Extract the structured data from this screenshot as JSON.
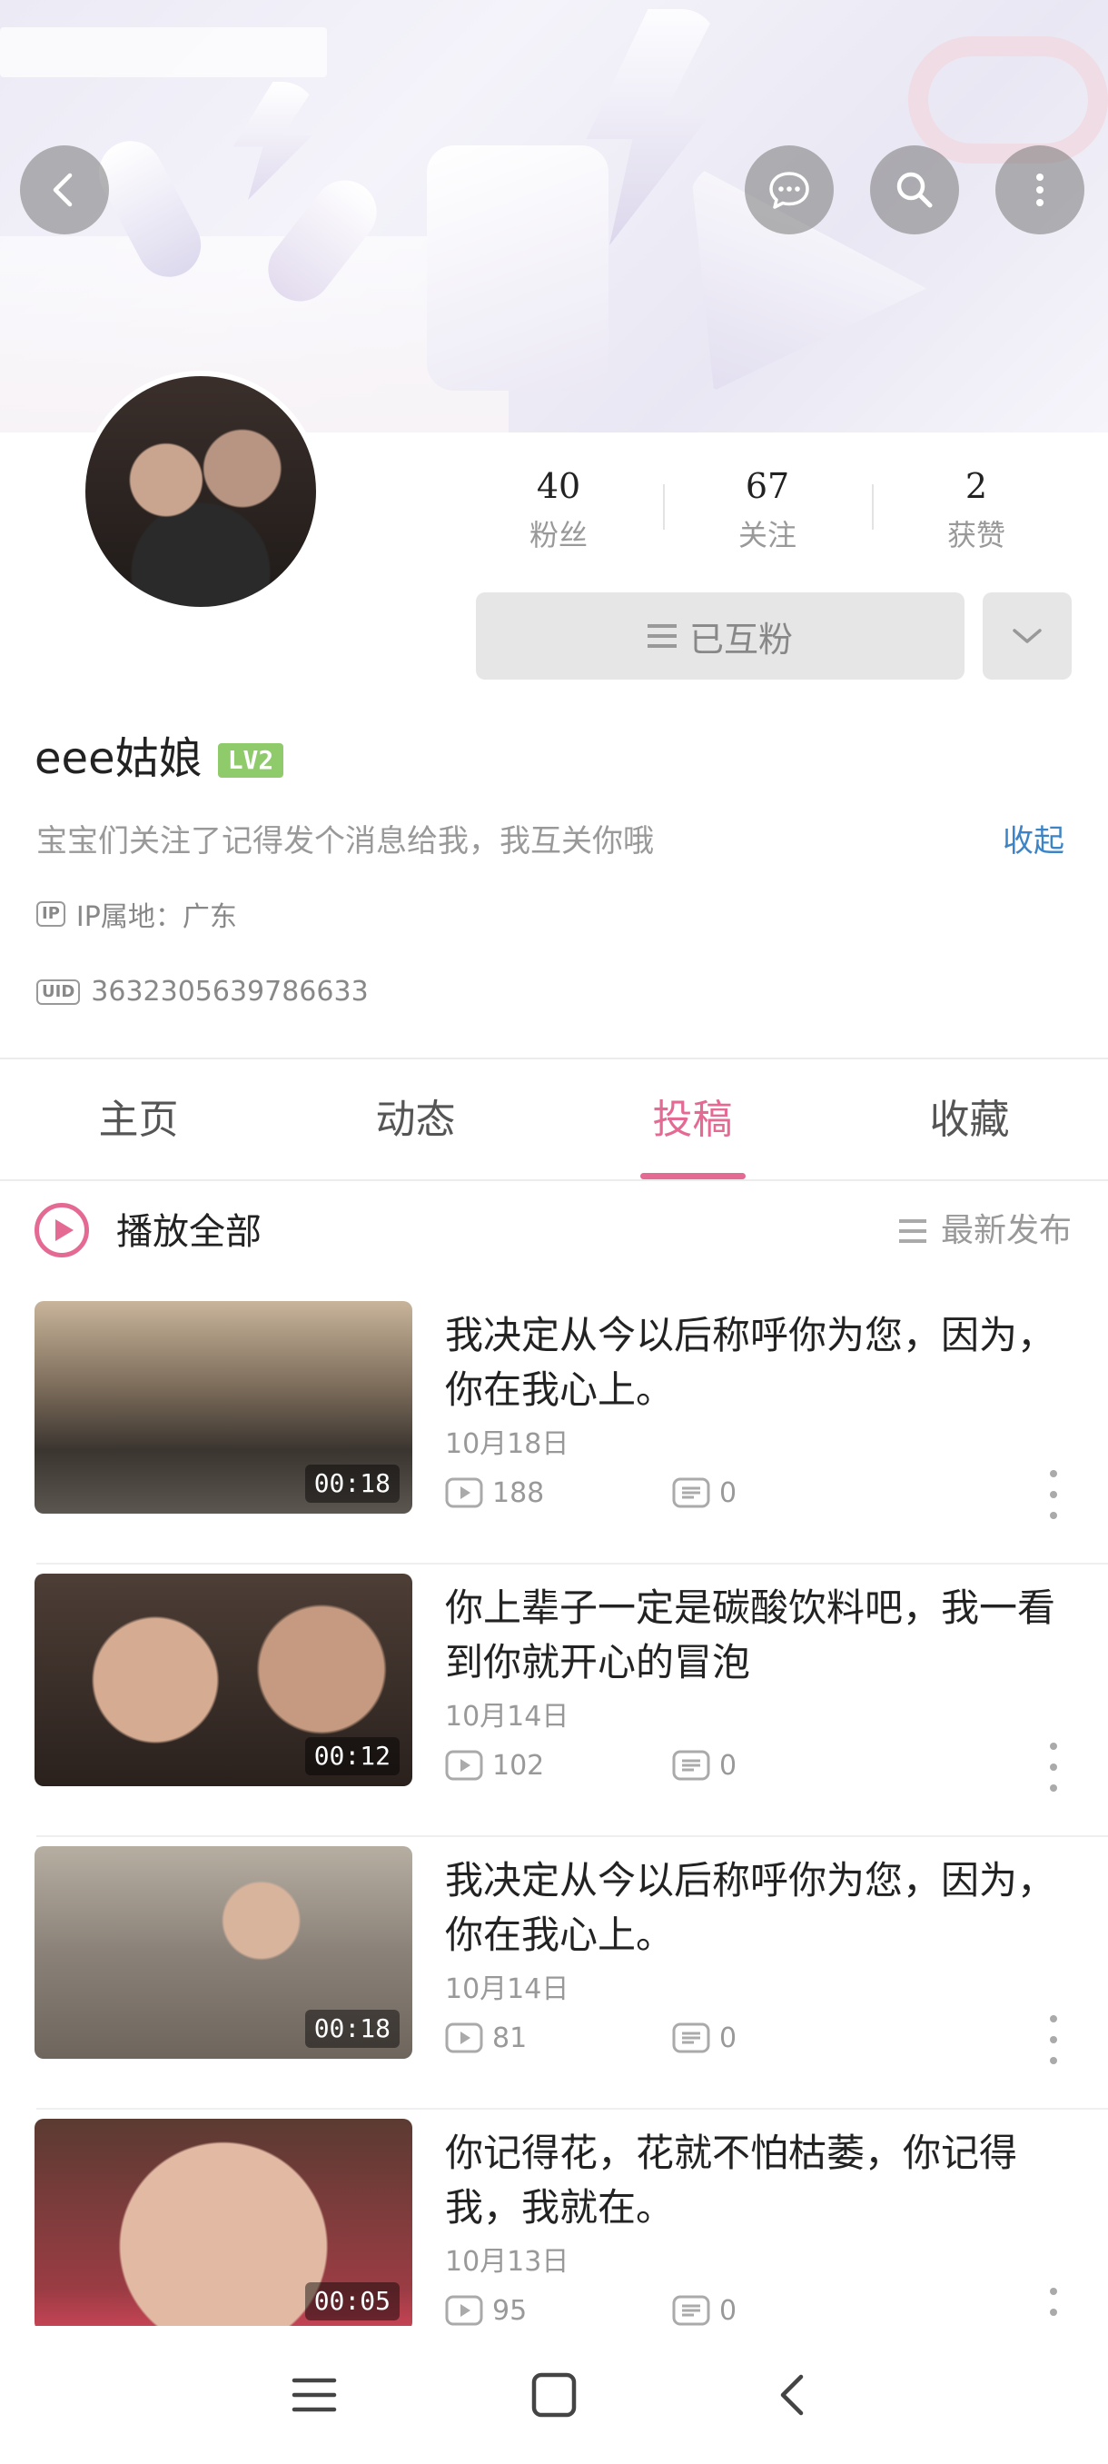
{
  "header": {
    "back_icon": "chevron-left-icon",
    "message_icon": "chat-bubble-icon",
    "search_icon": "search-icon",
    "more_icon": "more-vertical-icon"
  },
  "profile": {
    "stats": [
      {
        "value": "40",
        "label": "粉丝"
      },
      {
        "value": "67",
        "label": "关注"
      },
      {
        "value": "2",
        "label": "获赞"
      }
    ],
    "follow_status": "已互粉",
    "username": "eee姑娘",
    "level": "LV2",
    "bio": "宝宝们关注了记得发个消息给我，我互关你哦",
    "collapse": "收起",
    "ip_tag": "IP",
    "ip_location": "IP属地：广东",
    "uid_tag": "UID",
    "uid": "3632305639786633"
  },
  "tabs": [
    {
      "label": "主页",
      "active": false
    },
    {
      "label": "动态",
      "active": false
    },
    {
      "label": "投稿",
      "active": true
    },
    {
      "label": "收藏",
      "active": false
    }
  ],
  "list_header": {
    "play_all": "播放全部",
    "sort": "最新发布"
  },
  "videos": [
    {
      "title": "我决定从今以后称呼你为您，因为，你在我心上。",
      "date": "10月18日",
      "plays": "188",
      "comments": "0",
      "duration": "00:18"
    },
    {
      "title": "你上辈子一定是碳酸饮料吧，我一看到你就开心的冒泡",
      "date": "10月14日",
      "plays": "102",
      "comments": "0",
      "duration": "00:12"
    },
    {
      "title": "我决定从今以后称呼你为您，因为，你在我心上。",
      "date": "10月14日",
      "plays": "81",
      "comments": "0",
      "duration": "00:18"
    },
    {
      "title": "你记得花，花就不怕枯萎，你记得我，我就在。",
      "date": "10月13日",
      "plays": "95",
      "comments": "0",
      "duration": "00:05"
    }
  ],
  "colors": {
    "accent": "#e46a93",
    "link": "#3d84c6",
    "level_badge": "#8fcb6b"
  }
}
